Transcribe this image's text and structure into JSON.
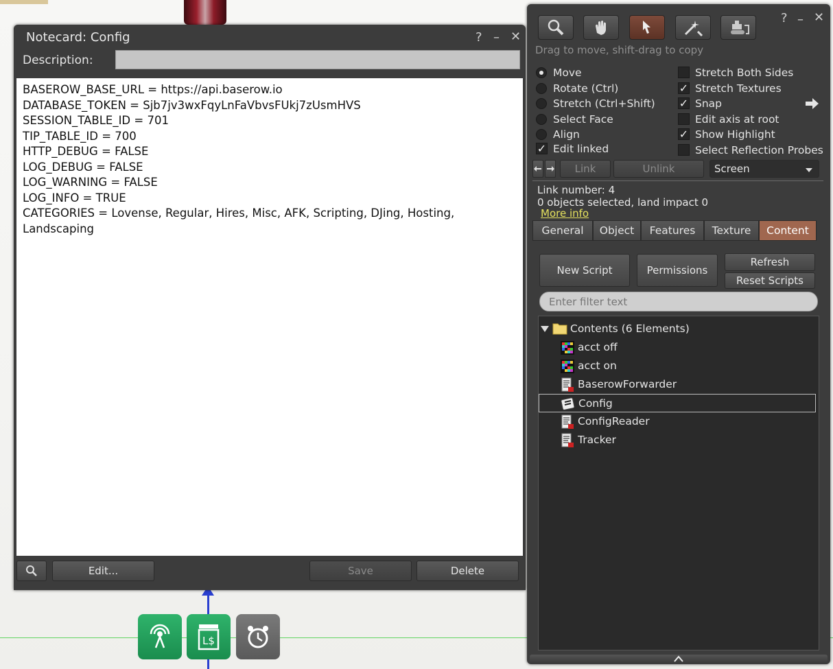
{
  "notecard": {
    "title": "Notecard: Config",
    "help": "?",
    "minimize": "–",
    "close": "✕",
    "description_label": "Description:",
    "description_value": "",
    "lines": [
      "BASEROW_BASE_URL = https://api.baserow.io",
      "DATABASE_TOKEN = Sjb7jv3wxFqyLnFaVbvsFUkj7zUsmHVS",
      "SESSION_TABLE_ID = 701",
      "TIP_TABLE_ID = 700",
      "HTTP_DEBUG = FALSE",
      "LOG_DEBUG = FALSE",
      "LOG_WARNING = FALSE",
      "LOG_INFO = TRUE",
      "CATEGORIES = Lovense, Regular, Hires, Misc, AFK, Scripting, DJing, Hosting,",
      "Landscaping"
    ],
    "buttons": {
      "edit": "Edit...",
      "save": "Save",
      "delete": "Delete"
    }
  },
  "build": {
    "help": "?",
    "minimize": "–",
    "close": "✕",
    "hint": "Drag to move, shift-drag to copy",
    "tools": [
      "focus-tool",
      "move-tool",
      "edit-tool",
      "create-tool",
      "land-tool"
    ],
    "radios": [
      {
        "label": "Move",
        "checked": true
      },
      {
        "label": "Rotate (Ctrl)",
        "checked": false
      },
      {
        "label": "Stretch (Ctrl+Shift)",
        "checked": false
      },
      {
        "label": "Select Face",
        "checked": false
      },
      {
        "label": "Align",
        "checked": false
      }
    ],
    "edit_linked": {
      "label": "Edit linked",
      "checked": true
    },
    "checks": [
      {
        "label": "Stretch Both Sides",
        "checked": false
      },
      {
        "label": "Stretch Textures",
        "checked": true
      },
      {
        "label": "Snap",
        "checked": true
      },
      {
        "label": "Edit axis at root",
        "checked": false
      },
      {
        "label": "Show Highlight",
        "checked": true
      },
      {
        "label": "Select Reflection Probes",
        "checked": false
      }
    ],
    "link_btn": "Link",
    "unlink_btn": "Unlink",
    "ruler_select": "Screen",
    "link_number": "Link number: 4",
    "selection_info": "0 objects selected, land impact 0",
    "more_info": "More info",
    "tabs": [
      "General",
      "Object",
      "Features",
      "Texture",
      "Content"
    ],
    "active_tab": "Content",
    "content": {
      "new_script": "New Script",
      "permissions": "Permissions",
      "refresh": "Refresh",
      "reset_scripts": "Reset Scripts",
      "filter_placeholder": "Enter filter text",
      "folder_label": "Contents (6 Elements)",
      "items": [
        {
          "name": "acct off",
          "type": "texture"
        },
        {
          "name": "acct on",
          "type": "texture"
        },
        {
          "name": "BaserowForwarder",
          "type": "script"
        },
        {
          "name": "Config",
          "type": "notecard",
          "selected": true
        },
        {
          "name": "ConfigReader",
          "type": "script"
        },
        {
          "name": "Tracker",
          "type": "script"
        }
      ]
    }
  }
}
